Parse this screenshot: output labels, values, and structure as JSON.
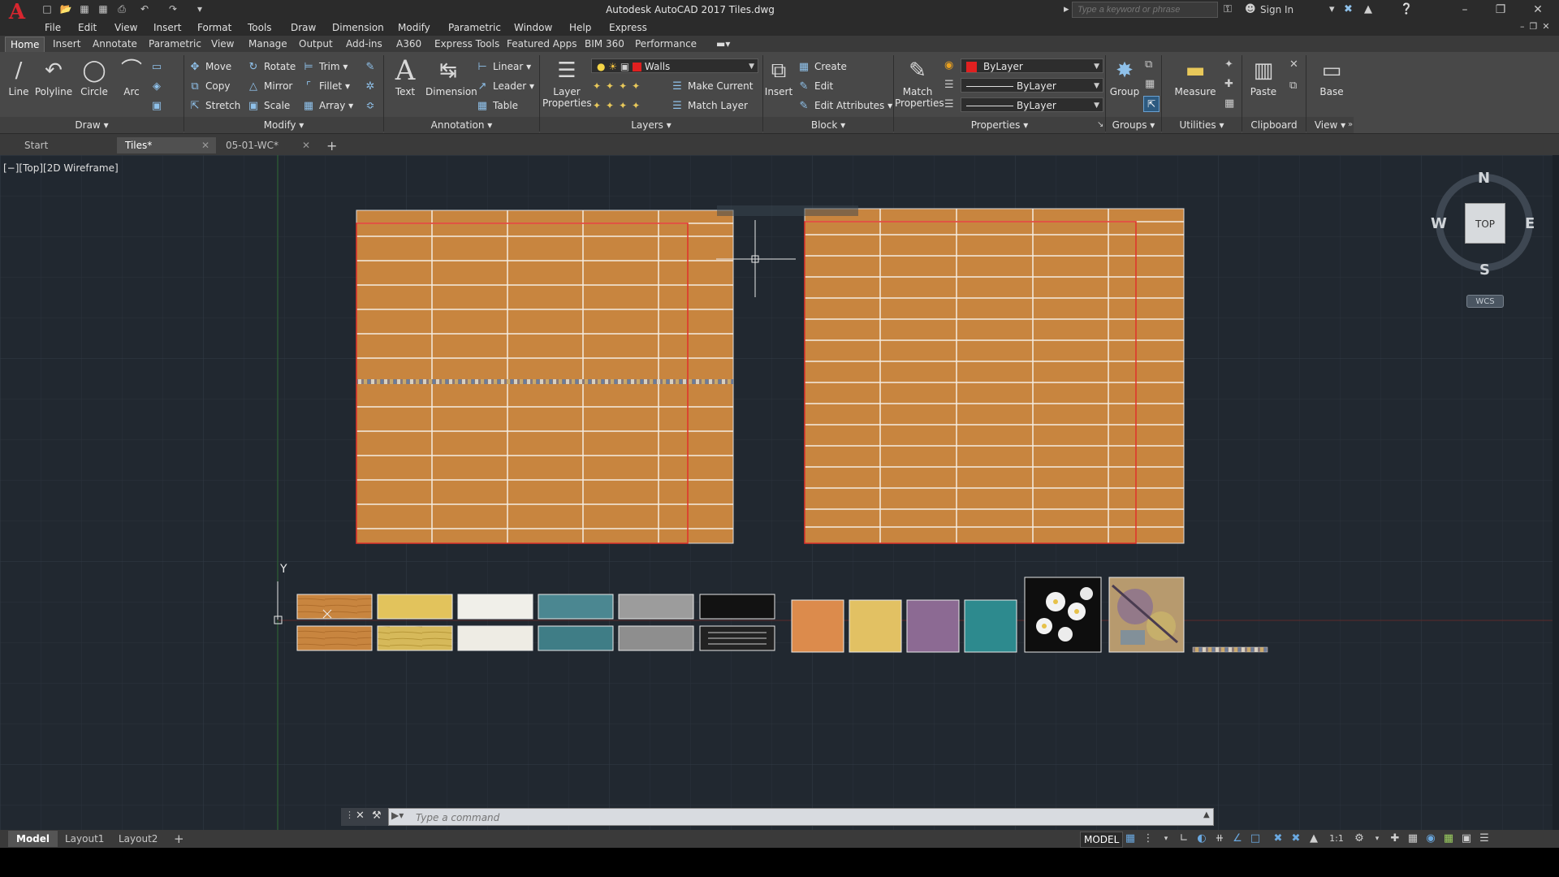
{
  "app": {
    "title": "Autodesk AutoCAD 2017    Tiles.dwg",
    "search_placeholder": "Type a keyword or phrase",
    "sign_in": "Sign In"
  },
  "menus": [
    "File",
    "Edit",
    "View",
    "Insert",
    "Format",
    "Tools",
    "Draw",
    "Dimension",
    "Modify",
    "Parametric",
    "Window",
    "Help",
    "Express"
  ],
  "ribbon_tabs": [
    "Home",
    "Insert",
    "Annotate",
    "Parametric",
    "View",
    "Manage",
    "Output",
    "Add-ins",
    "A360",
    "Express Tools",
    "Featured Apps",
    "BIM 360",
    "Performance"
  ],
  "draw": {
    "line": "Line",
    "polyline": "Polyline",
    "circle": "Circle",
    "arc": "Arc",
    "title": "Draw"
  },
  "modify": {
    "move": "Move",
    "copy": "Copy",
    "stretch": "Stretch",
    "rotate": "Rotate",
    "mirror": "Mirror",
    "scale": "Scale",
    "trim": "Trim",
    "fillet": "Fillet",
    "array": "Array",
    "title": "Modify"
  },
  "annotation": {
    "text": "Text",
    "dimension": "Dimension",
    "linear": "Linear",
    "leader": "Leader",
    "table": "Table",
    "title": "Annotation"
  },
  "layers": {
    "layer_properties": "Layer\nProperties",
    "current_layer": "Walls",
    "make_current": "Make Current",
    "match_layer": "Match Layer",
    "title": "Layers"
  },
  "block": {
    "insert": "Insert",
    "create": "Create",
    "edit": "Edit",
    "edit_attributes": "Edit Attributes",
    "title": "Block"
  },
  "properties": {
    "match": "Match\nProperties",
    "color": "ByLayer",
    "linetype": "ByLayer",
    "lineweight": "ByLayer",
    "title": "Properties"
  },
  "groups": {
    "group": "Group",
    "title": "Groups"
  },
  "utilities": {
    "measure": "Measure",
    "title": "Utilities"
  },
  "clipboard": {
    "paste": "Paste",
    "title": "Clipboard"
  },
  "view_panel": {
    "base": "Base",
    "title": "View"
  },
  "file_tabs": [
    {
      "label": "Start"
    },
    {
      "label": "Tiles*",
      "active": true
    },
    {
      "label": "05-01-WC*"
    }
  ],
  "viewport": {
    "label": "[−][Top][2D Wireframe]",
    "viewcube": {
      "n": "N",
      "s": "S",
      "e": "E",
      "w": "W",
      "face": "TOP",
      "wcs": "WCS"
    },
    "ucs_label": "Y"
  },
  "colors": {
    "viewport_bg": "#212830",
    "tile_orange": "#c8853f",
    "tile_yellow": "#e2c35c",
    "tile_white": "#f0efe9",
    "tile_teal": "#4b8791",
    "tile_grey": "#9c9c9c",
    "tile_black": "#121212",
    "sq_orange": "#dc8b4c",
    "sq_yellow": "#e2c163",
    "sq_purple": "#8c6a93",
    "sq_teal": "#2d8a8e",
    "outline_red": "#e0322b",
    "accent_red": "#d8262f"
  },
  "command": {
    "placeholder": "Type a command"
  },
  "layout_tabs": [
    "Model",
    "Layout1",
    "Layout2"
  ],
  "status": {
    "model": "MODEL",
    "scale": "1:1"
  }
}
